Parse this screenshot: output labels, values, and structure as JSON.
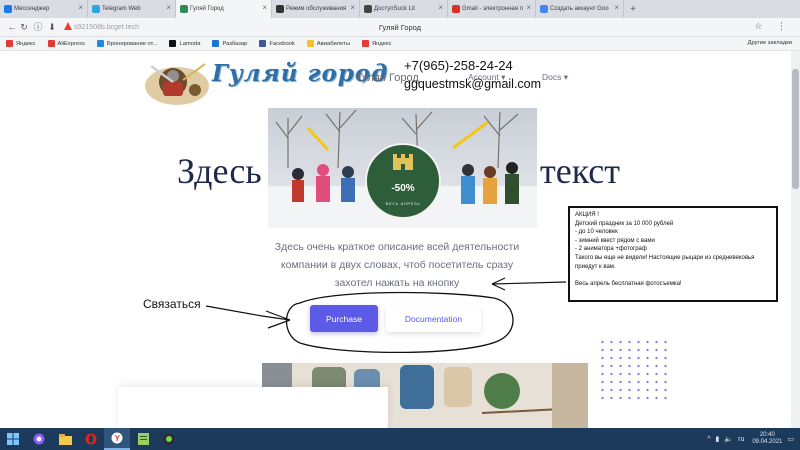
{
  "browser": {
    "tabs": [
      {
        "label": "Мессенджер",
        "color": "#1877f2"
      },
      {
        "label": "Telegram Web",
        "color": "#2ca5e0"
      },
      {
        "label": "Гуляй Город",
        "color": "#2e8b57",
        "active": true
      },
      {
        "label": "Режим обслуживания",
        "color": "#333333"
      },
      {
        "label": "ДоступSuck Lit",
        "color": "#444444"
      },
      {
        "label": "Gmail - электронная п",
        "color": "#d93025"
      },
      {
        "label": "Создать аккаунт Goo",
        "color": "#4285f4"
      }
    ],
    "url": "s921508b.bcget.tech",
    "page_title": "Гуляй Город",
    "bookmarks": [
      {
        "label": "Яндекс",
        "color": "#e53935"
      },
      {
        "label": "AliExpress",
        "color": "#e53935"
      },
      {
        "label": "Бронирование от...",
        "color": "#1e88e5"
      },
      {
        "label": "Lamoda",
        "color": "#111111"
      },
      {
        "label": "Разбазар",
        "color": "#1976d2"
      },
      {
        "label": "Facebook",
        "color": "#3b5998"
      },
      {
        "label": "Авиабилеты",
        "color": "#fbc02d"
      },
      {
        "label": "Яндекс",
        "color": "#e53935"
      }
    ],
    "bookmarks_right": "Другие закладки"
  },
  "site": {
    "logo_text": "Гуляй город",
    "brand_name": "Гуляй Город",
    "nav": {
      "account": "Account ▾",
      "docs": "Docs ▾"
    },
    "phone": "+7(965)-258-24-24",
    "email": "ggquestmsk@gmail.com",
    "hero_title_left": "Здесь",
    "hero_title_right": "текст",
    "badge": {
      "percent": "-50%",
      "subtitle": "ВЕСЬ АПРЕЛЬ"
    },
    "description": "Здесь очень краткое описание всей деятельности компании в двух словах, чтоб посетитель сразу захотел нажать на кнопку",
    "purchase_label": "Purchase",
    "documentation_label": "Documentation",
    "contact_label": "Связаться"
  },
  "promo": {
    "title": "АКЦИЯ !",
    "lines": [
      "Детский праздник за 10 000 рублей",
      "- до 10 человек",
      "- зимний квест рядом с вами",
      "- 2 аниматора +фотограф",
      "Такого вы еще не видели! Настоящие рыцари из средневековья приедут к вам.",
      "",
      "Весь апрель бесплатная фотосъемка!"
    ]
  },
  "taskbar": {
    "apps": [
      "start",
      "alice",
      "explorer",
      "opera",
      "yandex",
      "notepad",
      "video"
    ],
    "clock_time": "20:40",
    "clock_date": "09.04.2021",
    "tray_lang": "ru"
  },
  "colors": {
    "accent": "#5b5be8",
    "title": "#1f2a4a",
    "taskbar": "#1b3a5c",
    "badge_green": "#2e5d3a"
  }
}
